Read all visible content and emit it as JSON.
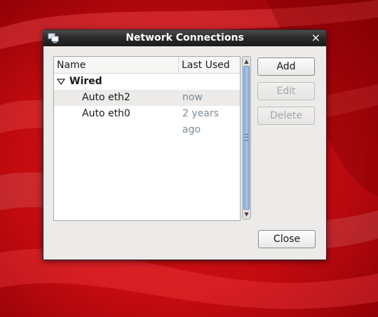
{
  "desktop": {
    "background_color": "#c4060c"
  },
  "window": {
    "title": "Network Connections",
    "title_icon": "network-connections-icon",
    "close_glyph": "×"
  },
  "connections_list": {
    "columns": {
      "name": "Name",
      "last_used": "Last Used"
    },
    "groups": [
      {
        "label": "Wired",
        "expanded": true,
        "items": [
          {
            "name": "Auto eth2",
            "last_used": "now",
            "selected": true
          },
          {
            "name": "Auto eth0",
            "last_used": "2 years ago",
            "selected": false
          }
        ]
      }
    ]
  },
  "buttons": {
    "add": "Add",
    "edit": "Edit",
    "delete": "Delete",
    "close": "Close"
  },
  "colors": {
    "titlebar": "#2b2b2b",
    "dialog": "#ecebe9",
    "muted_text": "#7d8a95",
    "scroll_thumb": "#a9c6ea"
  }
}
